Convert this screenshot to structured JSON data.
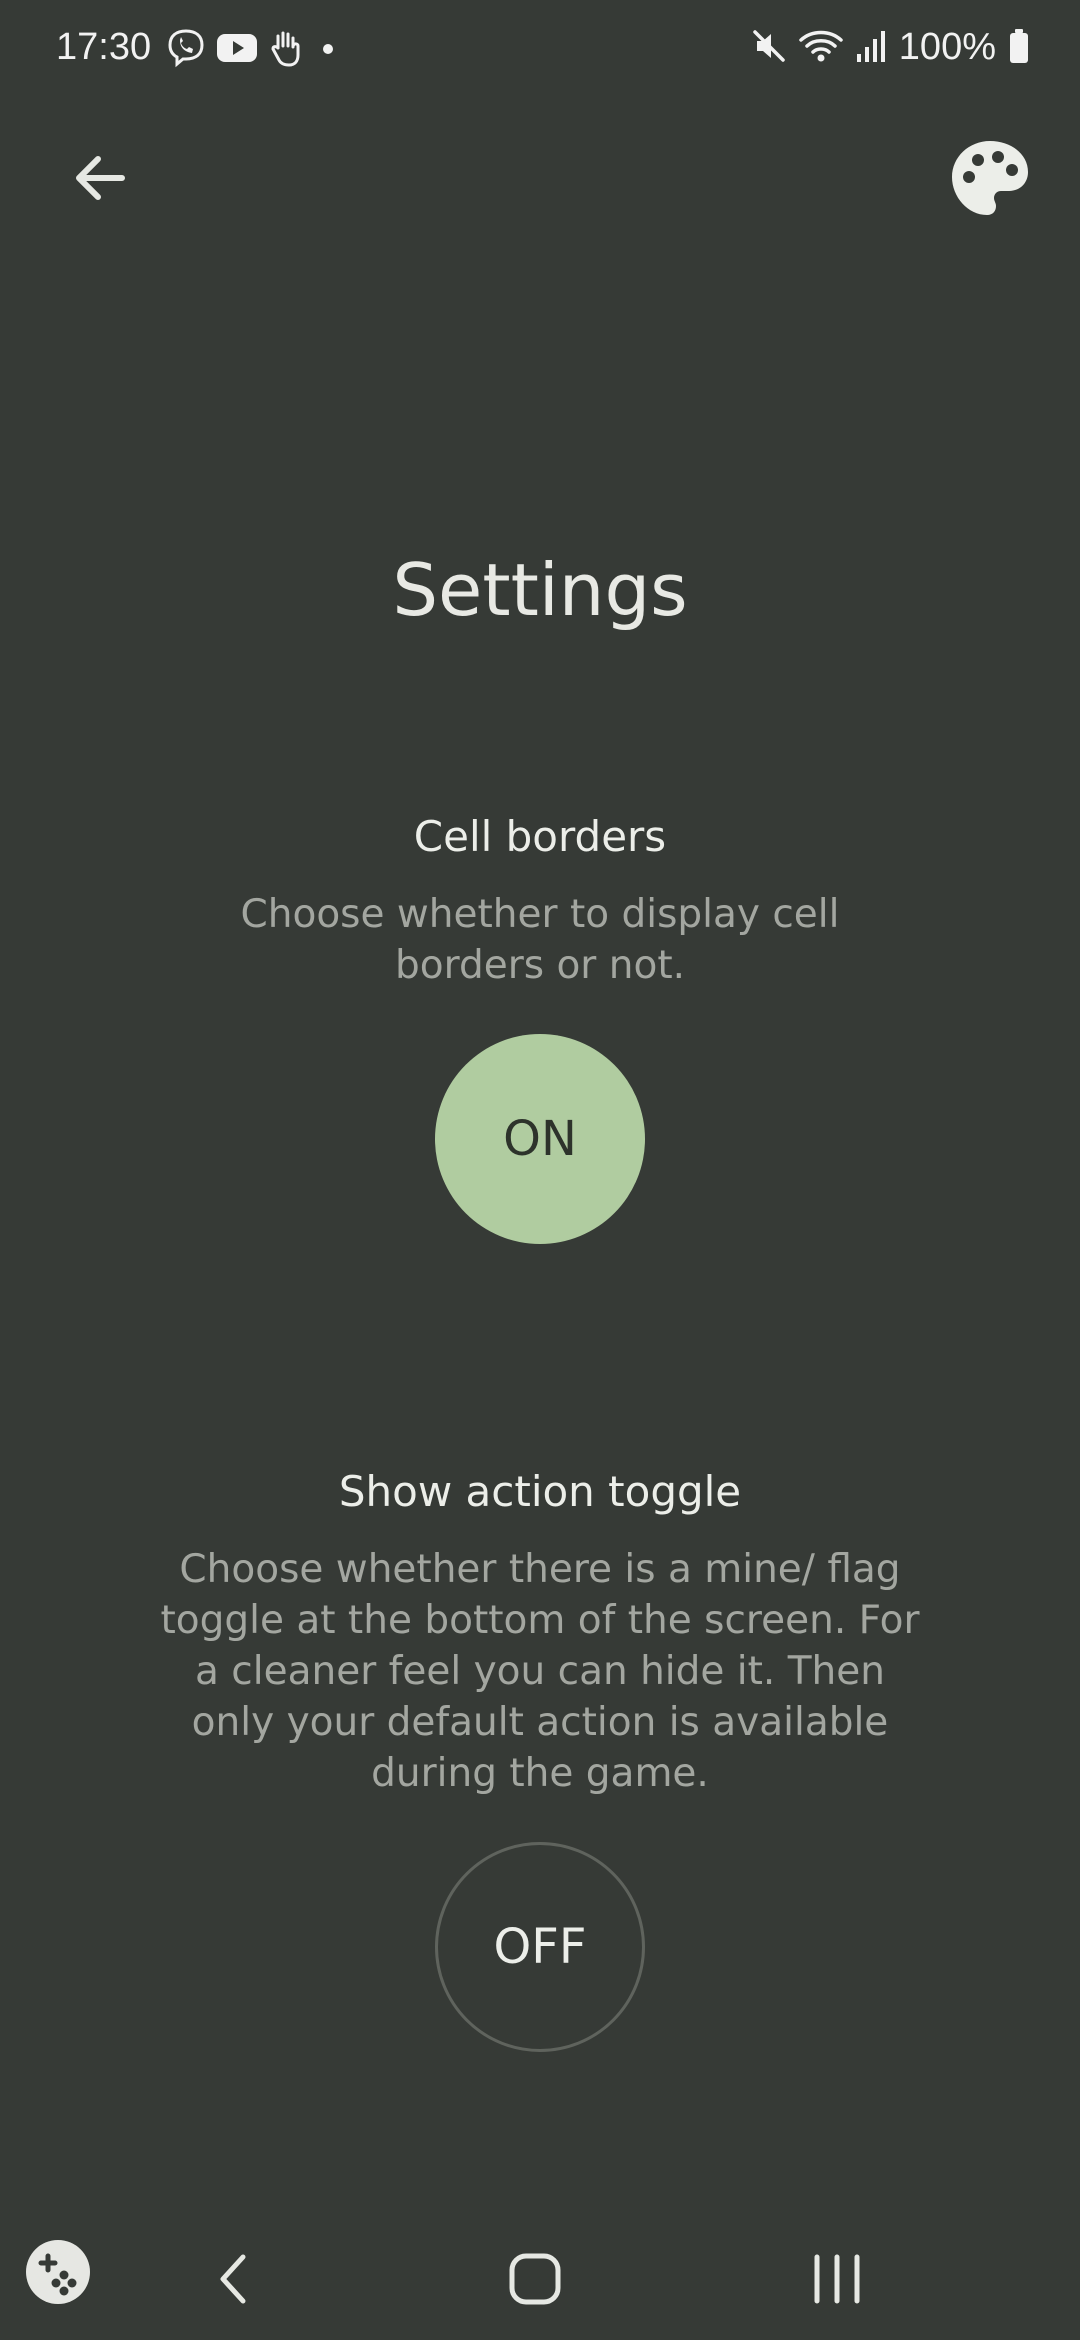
{
  "status_bar": {
    "time": "17:30",
    "battery": "100%",
    "notification_icons": [
      "viber-icon",
      "youtube-icon",
      "hand-icon",
      "dot-icon"
    ],
    "system_icons": [
      "mute-icon",
      "wifi-icon",
      "signal-icon",
      "battery-icon"
    ]
  },
  "header": {
    "back_icon": "arrow-left-icon",
    "palette_icon": "palette-icon"
  },
  "main": {
    "title": "Settings",
    "settings": [
      {
        "title": "Cell borders",
        "description": "Choose whether to display cell borders or not.",
        "toggle_label": "ON",
        "enabled": true
      },
      {
        "title": "Show action toggle",
        "description": "Choose whether there is a mine/ flag toggle at the bottom of the screen. For a cleaner feel you can hide it. Then only your default action is available during the game.",
        "toggle_label": "OFF",
        "enabled": false
      }
    ]
  },
  "nav_bar": {
    "icons": [
      "game-launcher-icon",
      "nav-back-icon",
      "nav-home-icon",
      "nav-recents-icon"
    ]
  },
  "colors": {
    "background": "#363a36",
    "toggle_on": "#b0cca0",
    "text_primary": "#eceee9",
    "text_secondary": "#a3a6a0"
  }
}
